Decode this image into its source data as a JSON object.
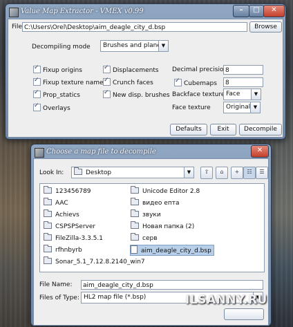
{
  "main_window": {
    "title": "Value Map Extractor - VMEX v0.99",
    "controls": {
      "minimize": "–",
      "maximize": "□",
      "close": "✕"
    },
    "file_label": "File",
    "file_path": "C:\\Users\\Orel\\Desktop\\aim_deagle_city_d.bsp",
    "browse_label": "Browse",
    "decompiling_mode_label": "Decompiling mode",
    "decompiling_mode_value": "Brushes and planes",
    "checkboxes": [
      {
        "label": "Fixup origins",
        "checked": true
      },
      {
        "label": "Displacements",
        "checked": true
      },
      {
        "label": "Fixup texture names",
        "checked": true
      },
      {
        "label": "Crunch faces",
        "checked": true
      },
      {
        "label": "Prop_statics",
        "checked": true
      },
      {
        "label": "New disp. brushes",
        "checked": true
      },
      {
        "label": "Overlays",
        "checked": true
      }
    ],
    "decimal_precision_label": "Decimal precision",
    "decimal_precision_value": "8",
    "cubemaps_label": "Cubemaps",
    "cubemaps_checked": true,
    "cubemaps_value": "8",
    "backface_texture_label": "Backface texture",
    "backface_texture_value": "Face",
    "face_texture_label": "Face texture",
    "face_texture_value": "Original",
    "defaults_label": "Defaults",
    "exit_label": "Exit",
    "decompile_label": "Decompile"
  },
  "file_dialog": {
    "title": "Choose a map file to decompile",
    "close": "✕",
    "look_in_label": "Look In:",
    "look_in_value": "Desktop",
    "items_left": [
      {
        "name": "123456789",
        "type": "folder"
      },
      {
        "name": "AAC",
        "type": "folder"
      },
      {
        "name": "Achievs",
        "type": "folder"
      },
      {
        "name": "CSPSPServer",
        "type": "folder"
      },
      {
        "name": "FileZilla-3.3.5.1",
        "type": "folder"
      },
      {
        "name": "rfhnbyrb",
        "type": "folder"
      },
      {
        "name": "Sonar_5.1_7.12.8.2140_win7",
        "type": "folder"
      }
    ],
    "items_right": [
      {
        "name": "Unicode Editor 2.8",
        "type": "folder"
      },
      {
        "name": "видео епта",
        "type": "folder"
      },
      {
        "name": "звуки",
        "type": "folder"
      },
      {
        "name": "Новая папка (2)",
        "type": "folder"
      },
      {
        "name": "серв",
        "type": "folder"
      },
      {
        "name": "aim_deagle_city_d.bsp",
        "type": "file",
        "selected": true
      }
    ],
    "file_name_label": "File Name:",
    "file_name_value": "aim_deagle_city_d.bsp",
    "file_type_label": "Files of Type:",
    "file_type_value": "HL2 map file (*.bsp)"
  },
  "watermark": "ILSANNY.RU"
}
